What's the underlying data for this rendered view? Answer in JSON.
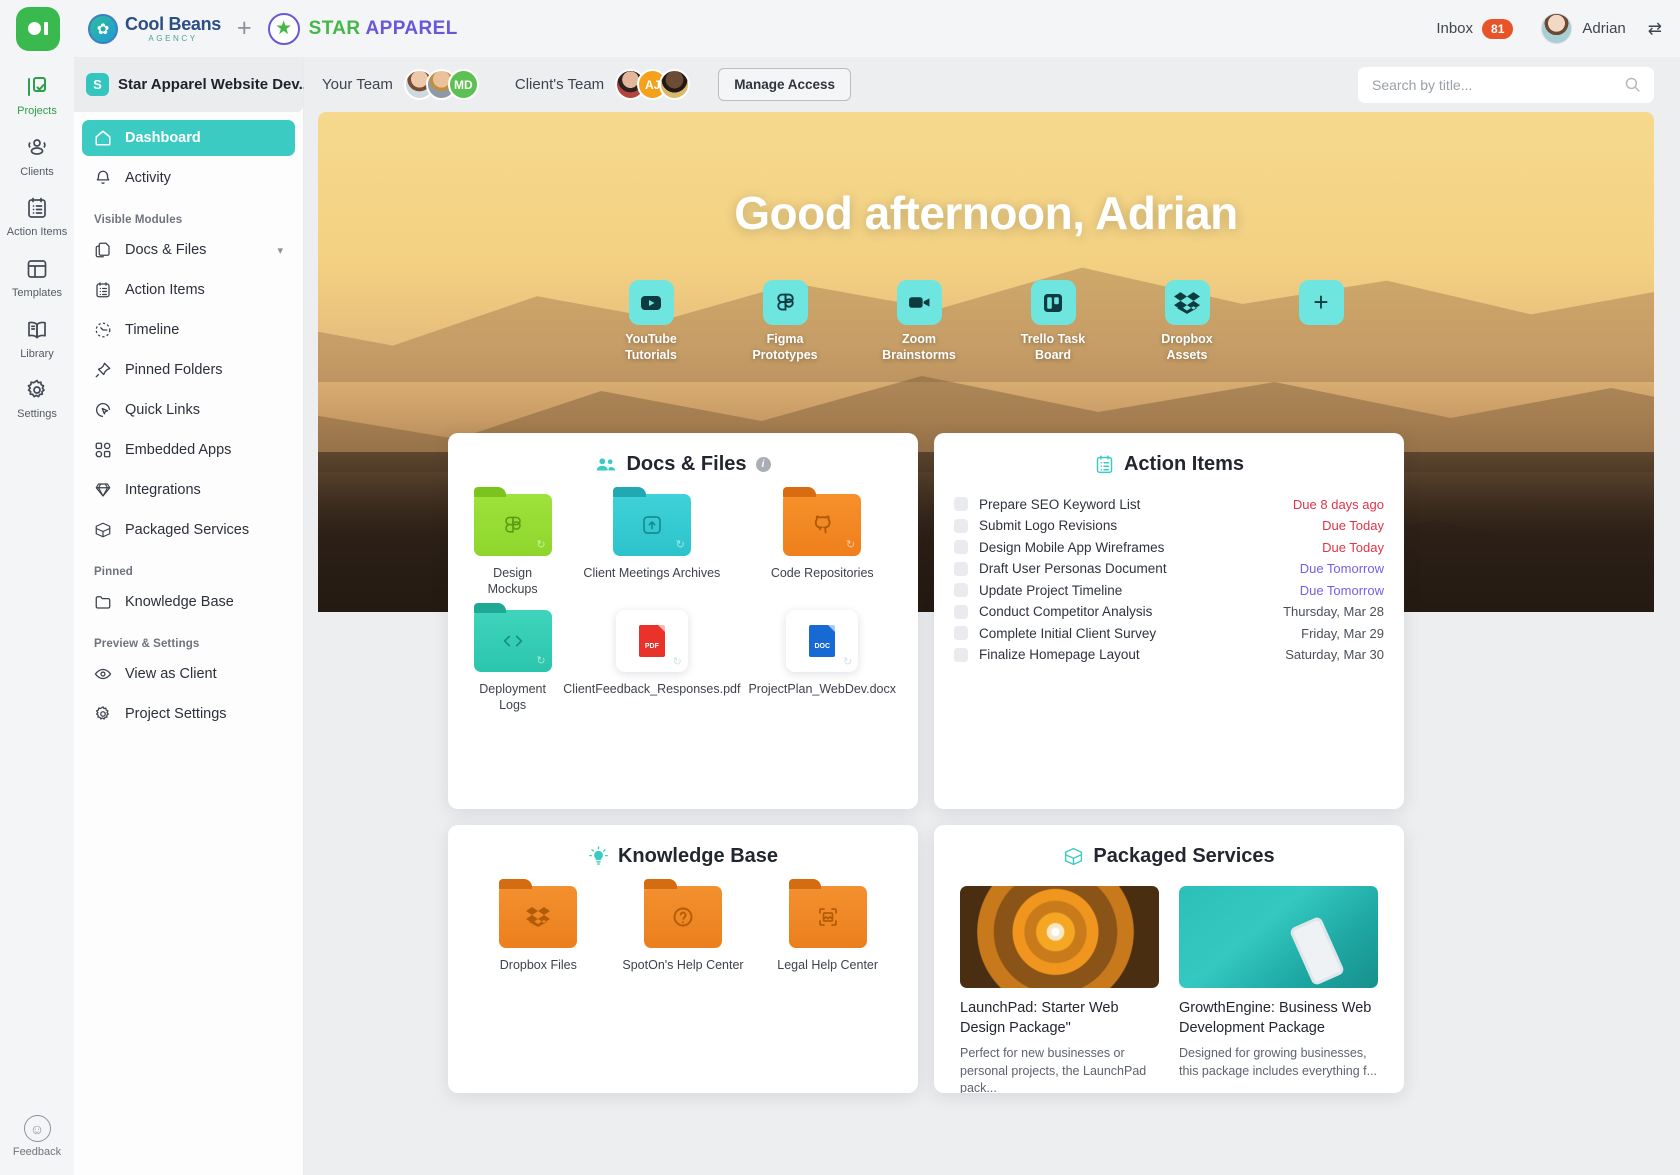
{
  "topbar": {
    "agency_name": "Cool Beans",
    "agency_sub": "AGENCY",
    "plus": "+",
    "client_star": "STAR",
    "client_apparel": "APPAREL",
    "inbox_label": "Inbox",
    "inbox_count": "81",
    "user_name": "Adrian"
  },
  "rail": {
    "items": [
      {
        "label": "Projects",
        "icon": "projects-icon",
        "active": true
      },
      {
        "label": "Clients",
        "icon": "clients-icon",
        "active": false
      },
      {
        "label": "Action Items",
        "icon": "action-items-icon",
        "active": false
      },
      {
        "label": "Templates",
        "icon": "templates-icon",
        "active": false
      },
      {
        "label": "Library",
        "icon": "library-icon",
        "active": false
      },
      {
        "label": "Settings",
        "icon": "settings-icon",
        "active": false
      }
    ],
    "feedback_label": "Feedback"
  },
  "sidebar": {
    "project_initial": "S",
    "project_title": "Star Apparel Website Dev...",
    "dashboard": "Dashboard",
    "activity": "Activity",
    "section_visible_modules": "Visible Modules",
    "section_pinned": "Pinned",
    "section_preview": "Preview & Settings",
    "modules": [
      {
        "label": "Docs & Files",
        "icon": "docs-files-icon",
        "chevron": true
      },
      {
        "label": "Action Items",
        "icon": "action-items-icon",
        "chevron": false
      },
      {
        "label": "Timeline",
        "icon": "timeline-icon",
        "chevron": false
      },
      {
        "label": "Pinned Folders",
        "icon": "pin-icon",
        "chevron": false
      },
      {
        "label": "Quick Links",
        "icon": "quick-links-icon",
        "chevron": false
      },
      {
        "label": "Embedded Apps",
        "icon": "embedded-apps-icon",
        "chevron": false
      },
      {
        "label": "Integrations",
        "icon": "integrations-icon",
        "chevron": false
      },
      {
        "label": "Packaged Services",
        "icon": "packaged-services-icon",
        "chevron": false
      }
    ],
    "pinned": [
      {
        "label": "Knowledge Base",
        "icon": "folder-icon"
      }
    ],
    "preview": [
      {
        "label": "View as Client",
        "icon": "eye-icon"
      },
      {
        "label": "Project Settings",
        "icon": "gear-icon"
      }
    ]
  },
  "subbar": {
    "your_team_label": "Your Team",
    "clients_team_label": "Client's Team",
    "your_team_initials": "MD",
    "clients_team_initials": "AJ",
    "manage_access": "Manage Access",
    "search_placeholder": "Search by title...",
    "search_value": ""
  },
  "hero": {
    "greeting": "Good afternoon, Adrian",
    "apps": [
      {
        "label": "YouTube\nTutorials",
        "line1": "YouTube",
        "line2": "Tutorials",
        "icon": "youtube-icon"
      },
      {
        "label": "Figma Prototypes",
        "line1": "Figma",
        "line2": "Prototypes",
        "icon": "figma-icon"
      },
      {
        "label": "Zoom Brainstorms",
        "line1": "Zoom",
        "line2": "Brainstorms",
        "icon": "zoom-icon"
      },
      {
        "label": "Trello Task Board",
        "line1": "Trello Task",
        "line2": "Board",
        "icon": "trello-icon"
      },
      {
        "label": "Dropbox Assets",
        "line1": "Dropbox",
        "line2": "Assets",
        "icon": "dropbox-icon"
      },
      {
        "label": "Add",
        "line1": "",
        "line2": "",
        "icon": "plus-icon"
      }
    ]
  },
  "docs_card": {
    "title": "Docs & Files",
    "icon": "people-icon",
    "info": "i",
    "items": [
      {
        "label": "Design Mockups",
        "kind": "folder",
        "color": "f-green",
        "glyph": "figma-icon"
      },
      {
        "label": "Client Meetings Archives",
        "kind": "folder",
        "color": "f-cyan",
        "glyph": "upload-box-icon"
      },
      {
        "label": "Code Repositories",
        "kind": "folder",
        "color": "f-orange",
        "glyph": "github-icon"
      },
      {
        "label": "Deployment Logs",
        "kind": "folder",
        "color": "f-teal",
        "glyph": "code-icon"
      },
      {
        "label": "ClientFeedback_Responses.pdf",
        "kind": "file",
        "color": "doc-pdf",
        "glyph": "pdf-icon",
        "ext": "PDF"
      },
      {
        "label": "ProjectPlan_WebDev.docx",
        "kind": "file",
        "color": "doc-doc",
        "glyph": "doc-icon",
        "ext": "DOC"
      }
    ]
  },
  "action_items_card": {
    "title": "Action Items",
    "icon": "clipboard-icon",
    "items": [
      {
        "task": "Prepare SEO Keyword List",
        "due": "Due 8 days ago",
        "due_style": "due-red"
      },
      {
        "task": "Submit Logo Revisions",
        "due": "Due Today",
        "due_style": "due-red"
      },
      {
        "task": "Design Mobile App Wireframes",
        "due": "Due Today",
        "due_style": "due-red"
      },
      {
        "task": "Draft User Personas Document",
        "due": "Due Tomorrow",
        "due_style": "due-pur"
      },
      {
        "task": "Update Project Timeline",
        "due": "Due Tomorrow",
        "due_style": "due-pur"
      },
      {
        "task": "Conduct Competitor Analysis",
        "due": "Thursday, Mar 28",
        "due_style": "due-gry"
      },
      {
        "task": "Complete Initial Client Survey",
        "due": "Friday, Mar 29",
        "due_style": "due-gry"
      },
      {
        "task": "Finalize Homepage Layout",
        "due": "Saturday, Mar 30",
        "due_style": "due-gry"
      }
    ]
  },
  "knowledge_base_card": {
    "title": "Knowledge Base",
    "icon": "lightbulb-icon",
    "items": [
      {
        "label": "Dropbox Files",
        "color": "f-orange2",
        "glyph": "dropbox-icon"
      },
      {
        "label": "SpotOn's Help Center",
        "color": "f-orange2",
        "glyph": "question-icon"
      },
      {
        "label": "Legal Help Center",
        "color": "f-orange2",
        "glyph": "image-icon"
      }
    ]
  },
  "packaged_services_card": {
    "title": "Packaged Services",
    "icon": "package-icon",
    "items": [
      {
        "title": "LaunchPad: Starter Web Design Package\"",
        "desc": "Perfect for new businesses or personal projects, the LaunchPad pack...",
        "img": "ps-1"
      },
      {
        "title": "GrowthEngine: Business Web Development Package",
        "desc": "Designed for growing businesses, this package includes everything f...",
        "img": "ps-2"
      }
    ]
  },
  "colors": {
    "accent_teal": "#3ccbc2",
    "brand_green": "#3aba4e",
    "badge_red": "#e8542a",
    "due_red": "#e0344a",
    "due_purple": "#7560e6"
  }
}
